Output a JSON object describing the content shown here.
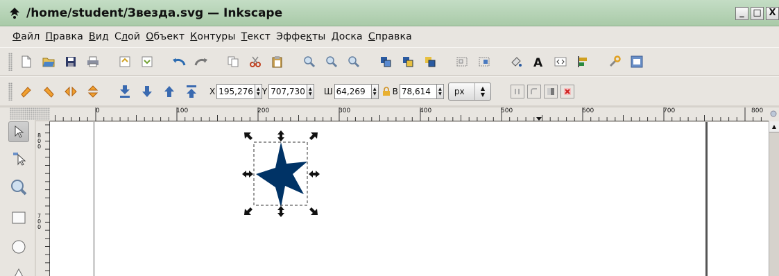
{
  "window": {
    "title": "/home/student/Звезда.svg — Inkscape",
    "controls": [
      "_",
      "□",
      "X"
    ]
  },
  "menu": [
    {
      "pre": "",
      "ul": "Ф",
      "post": "айл"
    },
    {
      "pre": "",
      "ul": "П",
      "post": "равка"
    },
    {
      "pre": "",
      "ul": "В",
      "post": "ид"
    },
    {
      "pre": "С",
      "ul": "л",
      "post": "ой"
    },
    {
      "pre": "",
      "ul": "О",
      "post": "бъект"
    },
    {
      "pre": "",
      "ul": "К",
      "post": "онтуры"
    },
    {
      "pre": "",
      "ul": "Т",
      "post": "екст"
    },
    {
      "pre": "Эффе",
      "ul": "к",
      "post": "ты"
    },
    {
      "pre": "",
      "ul": "Д",
      "post": "оска"
    },
    {
      "pre": "",
      "ul": "С",
      "post": "правка"
    }
  ],
  "toolbar_icons": [
    "new-icon",
    "open-icon",
    "save-icon",
    "print-icon",
    "import-icon",
    "export-icon",
    "undo-icon",
    "redo-icon",
    "copy-icon",
    "cut-icon",
    "paste-icon",
    "zoom-selection-icon",
    "zoom-drawing-icon",
    "zoom-page-icon",
    "duplicate-icon",
    "clone-icon",
    "unlink-clone-icon",
    "group-icon",
    "ungroup-icon",
    "fill-stroke-icon",
    "text-font-icon",
    "xml-editor-icon",
    "align-icon",
    "preferences-icon",
    "document-properties-icon"
  ],
  "controls": {
    "x_label": "X",
    "x_value": "195,276",
    "y_label": "Y",
    "y_value": "707,730",
    "w_label": "Ш",
    "w_value": "64,269",
    "h_label": "В",
    "h_value": "78,614",
    "unit": "px"
  },
  "hruler_labels": [
    "0",
    "100",
    "200",
    "300",
    "400",
    "500",
    "600",
    "700",
    "800"
  ],
  "vruler_labels": [
    "8\n0\n0",
    "7\n0\n0"
  ],
  "colors": {
    "star_fill": "#003366",
    "titlebar": "#b6d4b6",
    "canvas": "#ffffff"
  }
}
